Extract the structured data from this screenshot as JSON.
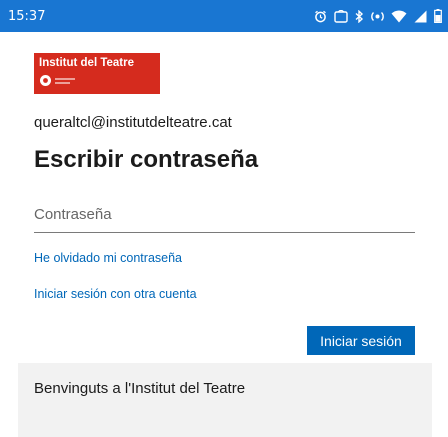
{
  "status_bar": {
    "time": "15:37",
    "icons": [
      "alarm-icon",
      "bluetooth-icon",
      "signal-icon",
      "wifi-icon",
      "cellular-icon",
      "battery-icon"
    ]
  },
  "logo": {
    "name": "Institut del Teatre"
  },
  "account": {
    "email": "queraltcl@institutdelteatre.cat"
  },
  "page": {
    "title": "Escribir contraseña"
  },
  "password": {
    "placeholder": "Contraseña",
    "value": ""
  },
  "links": {
    "forgot": "He olvidado mi contraseña",
    "other_account": "Iniciar sesión con otra cuenta"
  },
  "actions": {
    "sign_in": "Iniciar sesión"
  },
  "footer": {
    "welcome": "Benvinguts a l'Institut del Teatre"
  },
  "colors": {
    "status_bar": "#1976d2",
    "logo": "#d52b1e",
    "link": "#0067b8",
    "button": "#0067b8",
    "panel": "#f2f2f2"
  }
}
